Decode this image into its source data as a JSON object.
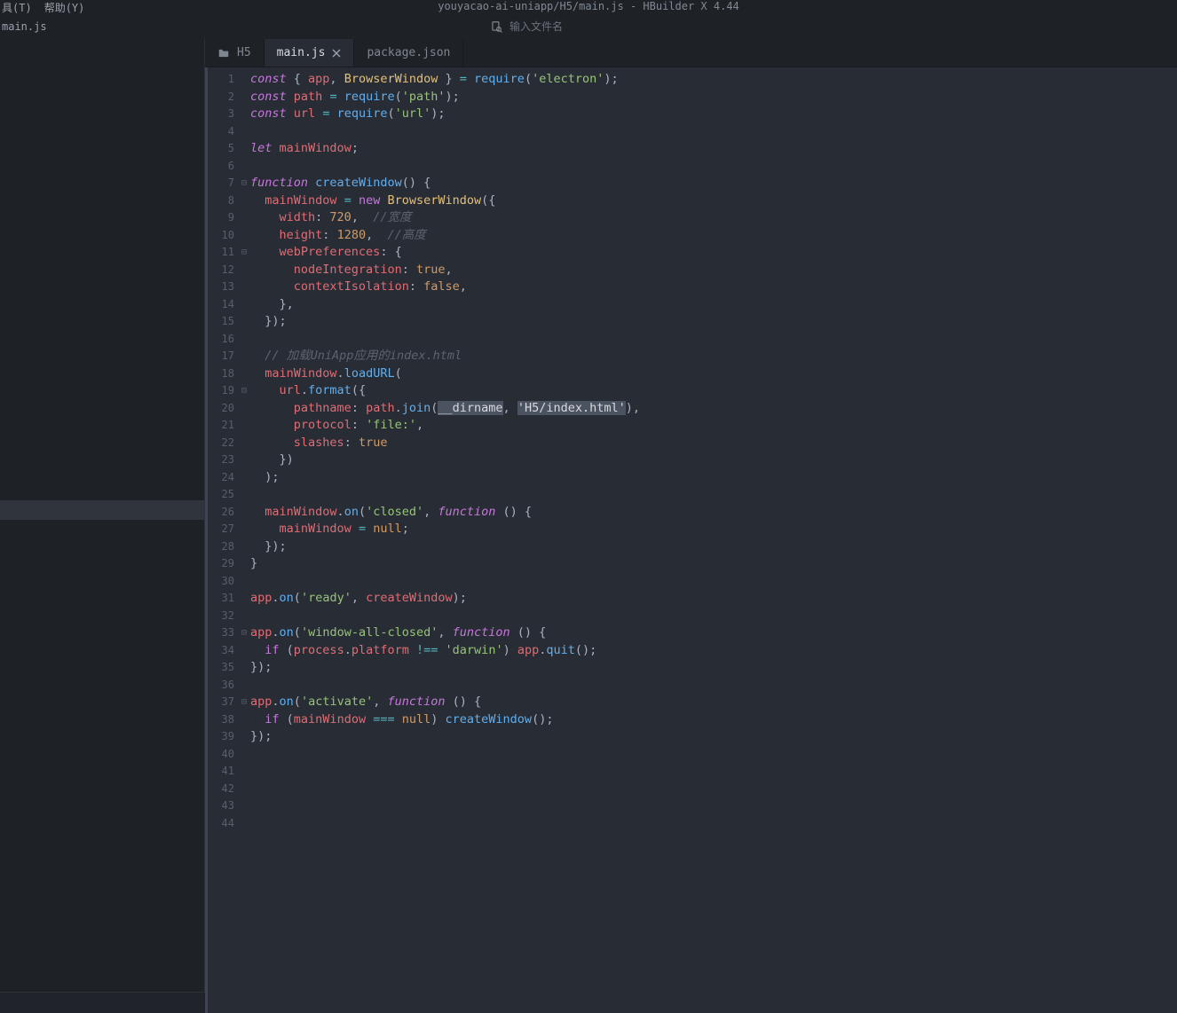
{
  "title": "youyacao-ai-uniapp/H5/main.js - HBuilder X 4.44",
  "menu": {
    "tools": "具(T)",
    "help": "帮助(Y)"
  },
  "secondbar": {
    "filename": "main.js",
    "search_placeholder": "输入文件名"
  },
  "tabs": [
    {
      "label": "H5",
      "icon": "folder",
      "active": false,
      "closable": false
    },
    {
      "label": "main.js",
      "icon": null,
      "active": true,
      "closable": true
    },
    {
      "label": "package.json",
      "icon": null,
      "active": false,
      "closable": false
    }
  ],
  "gutter": {
    "start": 1,
    "end": 44
  },
  "fold_markers": {
    "7": "⊟",
    "11": "⊟",
    "19": "⊟",
    "33": "⊟",
    "37": "⊟"
  },
  "code_lines": [
    [
      [
        "k-const",
        "const"
      ],
      [
        "k-plain",
        " { "
      ],
      [
        "k-var",
        "app"
      ],
      [
        "k-plain",
        ", "
      ],
      [
        "k-class",
        "BrowserWindow"
      ],
      [
        "k-plain",
        " } "
      ],
      [
        "k-op",
        "="
      ],
      [
        "k-plain",
        " "
      ],
      [
        "k-call",
        "require"
      ],
      [
        "k-plain",
        "("
      ],
      [
        "k-str",
        "'electron'"
      ],
      [
        "k-plain",
        ");"
      ]
    ],
    [
      [
        "k-const",
        "const"
      ],
      [
        "k-plain",
        " "
      ],
      [
        "k-var",
        "path"
      ],
      [
        "k-plain",
        " "
      ],
      [
        "k-op",
        "="
      ],
      [
        "k-plain",
        " "
      ],
      [
        "k-call",
        "require"
      ],
      [
        "k-plain",
        "("
      ],
      [
        "k-str",
        "'path'"
      ],
      [
        "k-plain",
        ");"
      ]
    ],
    [
      [
        "k-const",
        "const"
      ],
      [
        "k-plain",
        " "
      ],
      [
        "k-var",
        "url"
      ],
      [
        "k-plain",
        " "
      ],
      [
        "k-op",
        "="
      ],
      [
        "k-plain",
        " "
      ],
      [
        "k-call",
        "require"
      ],
      [
        "k-plain",
        "("
      ],
      [
        "k-str",
        "'url'"
      ],
      [
        "k-plain",
        ");"
      ]
    ],
    [],
    [
      [
        "k-const",
        "let"
      ],
      [
        "k-plain",
        " "
      ],
      [
        "k-var",
        "mainWindow"
      ],
      [
        "k-plain",
        ";"
      ]
    ],
    [],
    [
      [
        "k-func",
        "function"
      ],
      [
        "k-plain",
        " "
      ],
      [
        "k-call",
        "createWindow"
      ],
      [
        "k-plain",
        "() {"
      ]
    ],
    [
      [
        "k-plain",
        "  "
      ],
      [
        "k-var",
        "mainWindow"
      ],
      [
        "k-plain",
        " "
      ],
      [
        "k-op",
        "="
      ],
      [
        "k-plain",
        " "
      ],
      [
        "k-new",
        "new"
      ],
      [
        "k-plain",
        " "
      ],
      [
        "k-class",
        "BrowserWindow"
      ],
      [
        "k-plain",
        "({"
      ]
    ],
    [
      [
        "k-plain",
        "    "
      ],
      [
        "k-prop",
        "width"
      ],
      [
        "k-plain",
        ": "
      ],
      [
        "k-num",
        "720"
      ],
      [
        "k-plain",
        ",  "
      ],
      [
        "k-comment",
        "//宽度"
      ]
    ],
    [
      [
        "k-plain",
        "    "
      ],
      [
        "k-prop",
        "height"
      ],
      [
        "k-plain",
        ": "
      ],
      [
        "k-num",
        "1280"
      ],
      [
        "k-plain",
        ",  "
      ],
      [
        "k-comment",
        "//高度"
      ]
    ],
    [
      [
        "k-plain",
        "    "
      ],
      [
        "k-prop",
        "webPreferences"
      ],
      [
        "k-plain",
        ": {"
      ]
    ],
    [
      [
        "k-plain",
        "      "
      ],
      [
        "k-prop",
        "nodeIntegration"
      ],
      [
        "k-plain",
        ": "
      ],
      [
        "k-bool",
        "true"
      ],
      [
        "k-plain",
        ","
      ]
    ],
    [
      [
        "k-plain",
        "      "
      ],
      [
        "k-prop",
        "contextIsolation"
      ],
      [
        "k-plain",
        ": "
      ],
      [
        "k-bool",
        "false"
      ],
      [
        "k-plain",
        ","
      ]
    ],
    [
      [
        "k-plain",
        "    },"
      ]
    ],
    [
      [
        "k-plain",
        "  });"
      ]
    ],
    [],
    [
      [
        "k-plain",
        "  "
      ],
      [
        "k-comment",
        "// 加载UniApp应用的index.html"
      ]
    ],
    [
      [
        "k-plain",
        "  "
      ],
      [
        "k-var",
        "mainWindow"
      ],
      [
        "k-plain",
        "."
      ],
      [
        "k-call",
        "loadURL"
      ],
      [
        "k-plain",
        "("
      ]
    ],
    [
      [
        "k-plain",
        "    "
      ],
      [
        "k-var",
        "url"
      ],
      [
        "k-plain",
        "."
      ],
      [
        "k-call",
        "format"
      ],
      [
        "k-plain",
        "({"
      ]
    ],
    [
      [
        "k-plain",
        "      "
      ],
      [
        "k-prop",
        "pathname"
      ],
      [
        "k-plain",
        ": "
      ],
      [
        "k-var",
        "path"
      ],
      [
        "k-plain",
        "."
      ],
      [
        "k-call",
        "join"
      ],
      [
        "k-plain",
        "("
      ],
      [
        "hl",
        "__dirname"
      ],
      [
        "k-plain",
        ", "
      ],
      [
        "hl",
        "'H5/index.html'"
      ],
      [
        "k-plain",
        "),"
      ]
    ],
    [
      [
        "k-plain",
        "      "
      ],
      [
        "k-prop",
        "protocol"
      ],
      [
        "k-plain",
        ": "
      ],
      [
        "k-str",
        "'file:'"
      ],
      [
        "k-plain",
        ","
      ]
    ],
    [
      [
        "k-plain",
        "      "
      ],
      [
        "k-prop",
        "slashes"
      ],
      [
        "k-plain",
        ": "
      ],
      [
        "k-bool",
        "true"
      ]
    ],
    [
      [
        "k-plain",
        "    })"
      ]
    ],
    [
      [
        "k-plain",
        "  );"
      ]
    ],
    [],
    [
      [
        "k-plain",
        "  "
      ],
      [
        "k-var",
        "mainWindow"
      ],
      [
        "k-plain",
        "."
      ],
      [
        "k-call",
        "on"
      ],
      [
        "k-plain",
        "("
      ],
      [
        "k-str",
        "'closed'"
      ],
      [
        "k-plain",
        ", "
      ],
      [
        "k-func",
        "function"
      ],
      [
        "k-plain",
        " () {"
      ]
    ],
    [
      [
        "k-plain",
        "    "
      ],
      [
        "k-var",
        "mainWindow"
      ],
      [
        "k-plain",
        " "
      ],
      [
        "k-op",
        "="
      ],
      [
        "k-plain",
        " "
      ],
      [
        "k-bool",
        "null"
      ],
      [
        "k-plain",
        ";"
      ]
    ],
    [
      [
        "k-plain",
        "  });"
      ]
    ],
    [
      [
        "k-plain",
        "}"
      ]
    ],
    [],
    [
      [
        "k-var",
        "app"
      ],
      [
        "k-plain",
        "."
      ],
      [
        "k-call",
        "on"
      ],
      [
        "k-plain",
        "("
      ],
      [
        "k-str",
        "'ready'"
      ],
      [
        "k-plain",
        ", "
      ],
      [
        "k-var",
        "createWindow"
      ],
      [
        "k-plain",
        ");"
      ]
    ],
    [],
    [
      [
        "k-var",
        "app"
      ],
      [
        "k-plain",
        "."
      ],
      [
        "k-call",
        "on"
      ],
      [
        "k-plain",
        "("
      ],
      [
        "k-str",
        "'window-all-closed'"
      ],
      [
        "k-plain",
        ", "
      ],
      [
        "k-func",
        "function"
      ],
      [
        "k-plain",
        " () {"
      ]
    ],
    [
      [
        "k-plain",
        "  "
      ],
      [
        "k-key",
        "if"
      ],
      [
        "k-plain",
        " ("
      ],
      [
        "k-var",
        "process"
      ],
      [
        "k-plain",
        "."
      ],
      [
        "k-prop",
        "platform"
      ],
      [
        "k-plain",
        " "
      ],
      [
        "k-op",
        "!=="
      ],
      [
        "k-plain",
        " "
      ],
      [
        "k-str",
        "'darwin'"
      ],
      [
        "k-plain",
        ") "
      ],
      [
        "k-var",
        "app"
      ],
      [
        "k-plain",
        "."
      ],
      [
        "k-call",
        "quit"
      ],
      [
        "k-plain",
        "();"
      ]
    ],
    [
      [
        "k-plain",
        "});"
      ]
    ],
    [],
    [
      [
        "k-var",
        "app"
      ],
      [
        "k-plain",
        "."
      ],
      [
        "k-call",
        "on"
      ],
      [
        "k-plain",
        "("
      ],
      [
        "k-str",
        "'activate'"
      ],
      [
        "k-plain",
        ", "
      ],
      [
        "k-func",
        "function"
      ],
      [
        "k-plain",
        " () {"
      ]
    ],
    [
      [
        "k-plain",
        "  "
      ],
      [
        "k-key",
        "if"
      ],
      [
        "k-plain",
        " ("
      ],
      [
        "k-var",
        "mainWindow"
      ],
      [
        "k-plain",
        " "
      ],
      [
        "k-op",
        "==="
      ],
      [
        "k-plain",
        " "
      ],
      [
        "k-bool",
        "null"
      ],
      [
        "k-plain",
        ") "
      ],
      [
        "k-call",
        "createWindow"
      ],
      [
        "k-plain",
        "();"
      ]
    ],
    [
      [
        "k-plain",
        "});"
      ]
    ],
    [],
    [],
    [],
    [],
    []
  ]
}
